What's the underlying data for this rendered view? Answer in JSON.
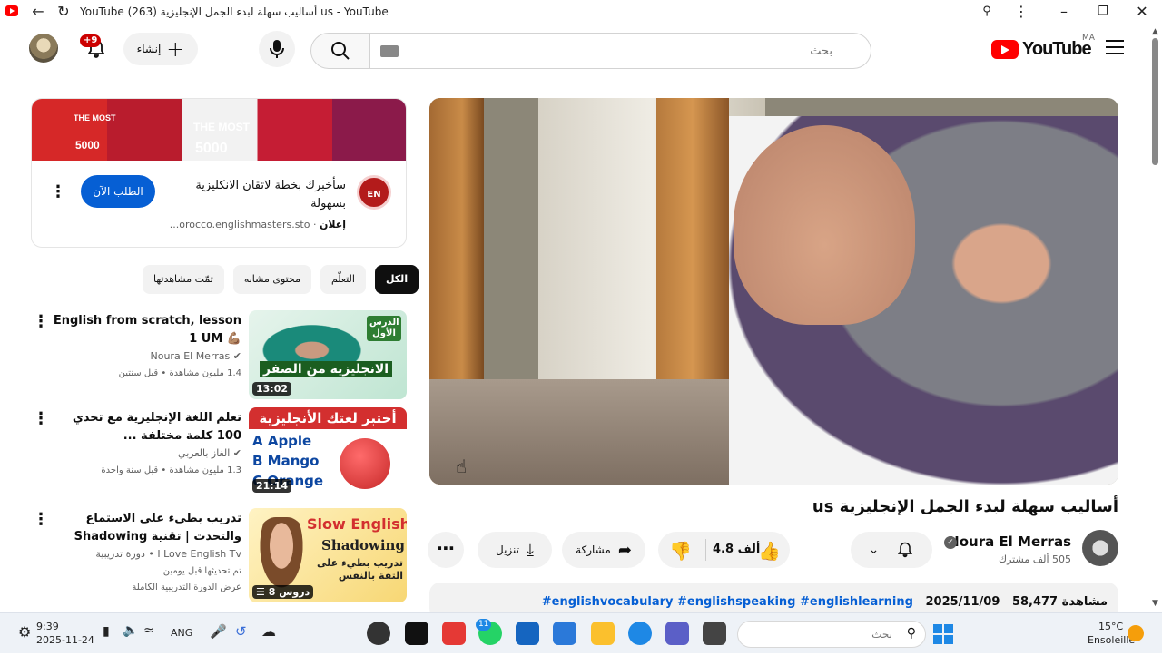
{
  "browser": {
    "title": "YouTube (263) أساليب سهلة لبدء الجمل الإنجليزية us - YouTube"
  },
  "masthead": {
    "notif_count": "+9",
    "create_label": "إنشاء",
    "search_placeholder": "بحث",
    "logo_word": "YouTube",
    "region": "MA"
  },
  "video": {
    "title": "أساليب سهلة لبدء الجمل الإنجليزية us",
    "channel": "Noura El Merras",
    "subscribers": "505 ألف مشترك",
    "likes": "4.8 ألف",
    "share_label": "مشاركة",
    "download_label": "تنزيل",
    "views": "58,477 مشاهدة",
    "date": "2025/11/09",
    "hashtags": "#englishvocabulary #englishspeaking #englishlearning"
  },
  "ad": {
    "banner_texts": [
      "THE MOST",
      "5000",
      "THE MOST",
      "5000"
    ],
    "icon_text": "EN",
    "title": "سأخبرك بخطة لاتقان الانكليزية بسهولة",
    "sponsored_label": "إعلان",
    "domain": "orocco.englishmasters.sto...",
    "cta": "الطلب الآن"
  },
  "chips": [
    {
      "label": "الكل",
      "active": true
    },
    {
      "label": "التعلّم",
      "active": false
    },
    {
      "label": "محتوى مشابه",
      "active": false
    },
    {
      "label": "تمّت مشاهدتها",
      "active": false
    }
  ],
  "recommendations": [
    {
      "title": "English from scratch, lesson 1 UM 💪🏽",
      "channel": "Noura El Merras",
      "meta": "1.4 مليون مشاهدة • قبل سنتين",
      "duration": "13:02",
      "thumb_text_1": "الدرس الأول",
      "thumb_text_2": "الانجليزية من الصفر"
    },
    {
      "title": "تعلم اللغة الإنجليزية مع تحدي 100 كلمة مختلفة ...",
      "channel": "الغاز بالعربي",
      "meta": "1.3 مليون مشاهدة • قبل سنة واحدة",
      "duration": "21:14",
      "thumb_text_1": "أختبر لغتك الأنجليزية",
      "thumb_options": [
        "A Apple",
        "B Mango",
        "C Orange"
      ]
    },
    {
      "title": "تدريب بطيء على الاستماع والتحدث | تقنية Shadowing",
      "channel": "I Love English Tv • دورة تدريبية",
      "meta": "تم تحديثها قبل يومين",
      "meta2": "عرض الدورة التدريبية الكاملة",
      "duration": "8 دروس",
      "thumb_text_1": "Slow English",
      "thumb_text_2": "Shadowing",
      "thumb_text_3": "تدريب بطيء على الثقة بالنفس"
    }
  ],
  "taskbar": {
    "time": "9:39",
    "date": "2025-11-24",
    "lang": "ANG",
    "search_placeholder": "بحث",
    "weather_temp": "15°C",
    "weather_desc": "Ensoleillé",
    "whatsapp_badge": "11"
  }
}
